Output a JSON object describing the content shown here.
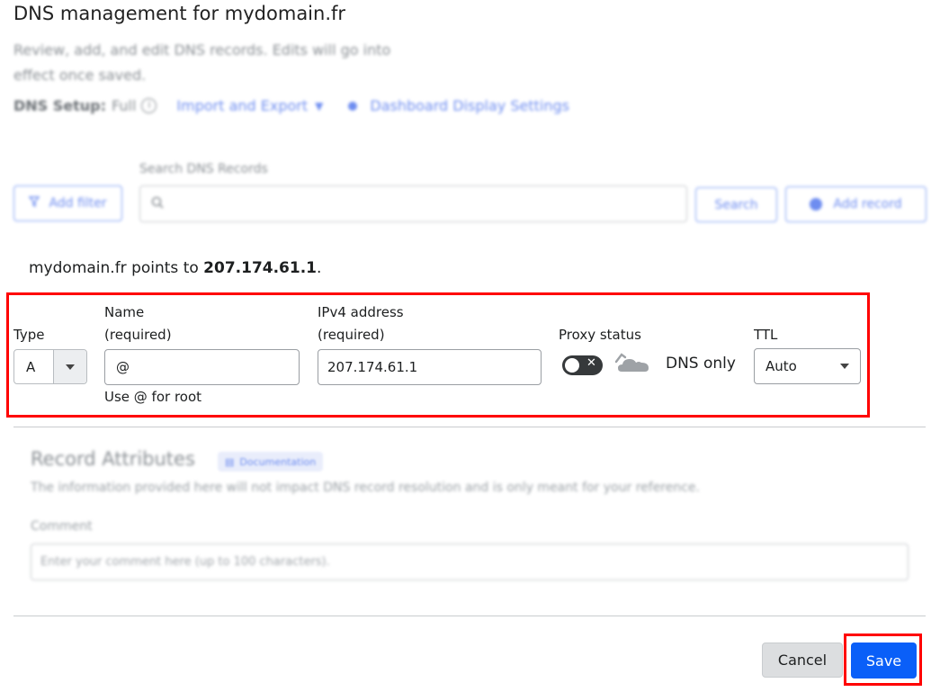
{
  "header": {
    "title_prefix": "DNS management for",
    "domain": "mydomain.fr",
    "description": "Review, add, and edit DNS records. Edits will go into effect once saved."
  },
  "dns_setup": {
    "label": "DNS Setup:",
    "value": "Full",
    "import_export": "Import and Export",
    "dashboard_settings": "Dashboard Display Settings"
  },
  "toolbar": {
    "add_filter": "Add filter",
    "search_label": "Search DNS Records",
    "search_button": "Search",
    "add_record": "Add record"
  },
  "points_to": {
    "domain": "mydomain.fr",
    "text": "points to",
    "ip": "207.174.61.1",
    "end": "."
  },
  "form": {
    "type_label": "Type",
    "type_value": "A",
    "name_label_1": "Name",
    "name_label_2": "(required)",
    "name_value": "@",
    "name_help": "Use @ for root",
    "ipv4_label_1": "IPv4 address",
    "ipv4_label_2": "(required)",
    "ipv4_value": "207.174.61.1",
    "proxy_label": "Proxy status",
    "proxy_state": "DNS only",
    "ttl_label": "TTL",
    "ttl_value": "Auto"
  },
  "record_attributes": {
    "title": "Record Attributes",
    "doc_badge": "Documentation",
    "description": "The information provided here will not impact DNS record resolution and is only meant for your reference.",
    "comment_label": "Comment",
    "comment_placeholder": "Enter your comment here (up to 100 characters)."
  },
  "footer": {
    "cancel": "Cancel",
    "save": "Save"
  },
  "colors": {
    "accent": "#0a5ff8",
    "highlight": "#ff0000"
  }
}
